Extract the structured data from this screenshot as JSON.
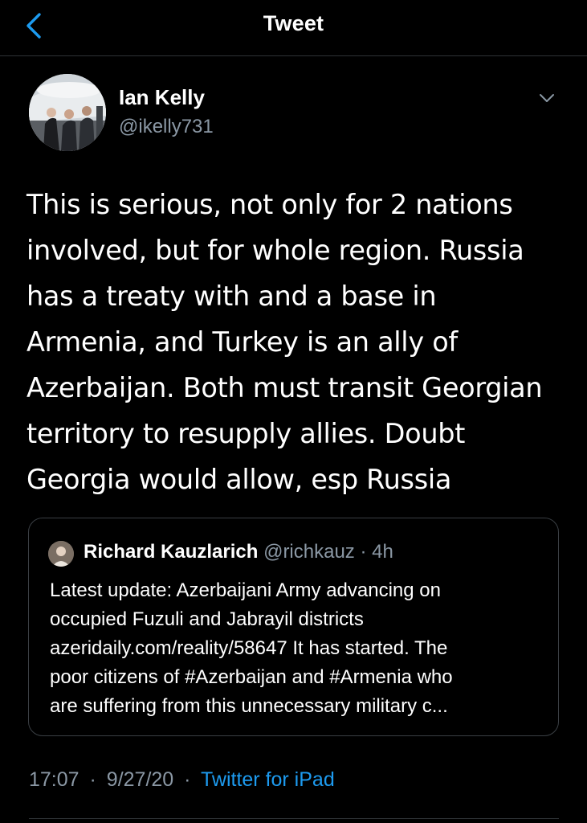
{
  "header": {
    "title": "Tweet"
  },
  "author": {
    "name": "Ian Kelly",
    "handle": "@ikelly731"
  },
  "tweet": {
    "lines": [
      "This is serious, not only for 2 nations",
      "involved, but for whole region. Russia",
      "has a treaty with and a base in",
      "Armenia, and Turkey is an ally of",
      "Azerbaijan. Both must transit Georgian",
      "territory to resupply allies. Doubt",
      "Georgia would allow, esp Russia"
    ]
  },
  "quote": {
    "name": "Richard Kauzlarich",
    "handle": "@richkauz",
    "dot": "·",
    "time": "4h",
    "lines": [
      "Latest update: Azerbaijani Army advancing on",
      "occupied Fuzuli and Jabrayil districts",
      "azeridaily.com/reality/58647 It has started. The",
      "poor citizens of #Azerbaijan and #Armenia who",
      "are suffering from this unnecessary military c..."
    ]
  },
  "footer": {
    "time": "17:07",
    "dot1": "·",
    "date": "9/27/20",
    "dot2": "·",
    "source": "Twitter for iPad"
  },
  "colors": {
    "background": "#000000",
    "secondary_text": "#8b98a5",
    "accent": "#1d9bf0",
    "border": "#2f3336"
  },
  "icons": {
    "back": "chevron-left-icon",
    "more": "chevron-down-icon"
  }
}
